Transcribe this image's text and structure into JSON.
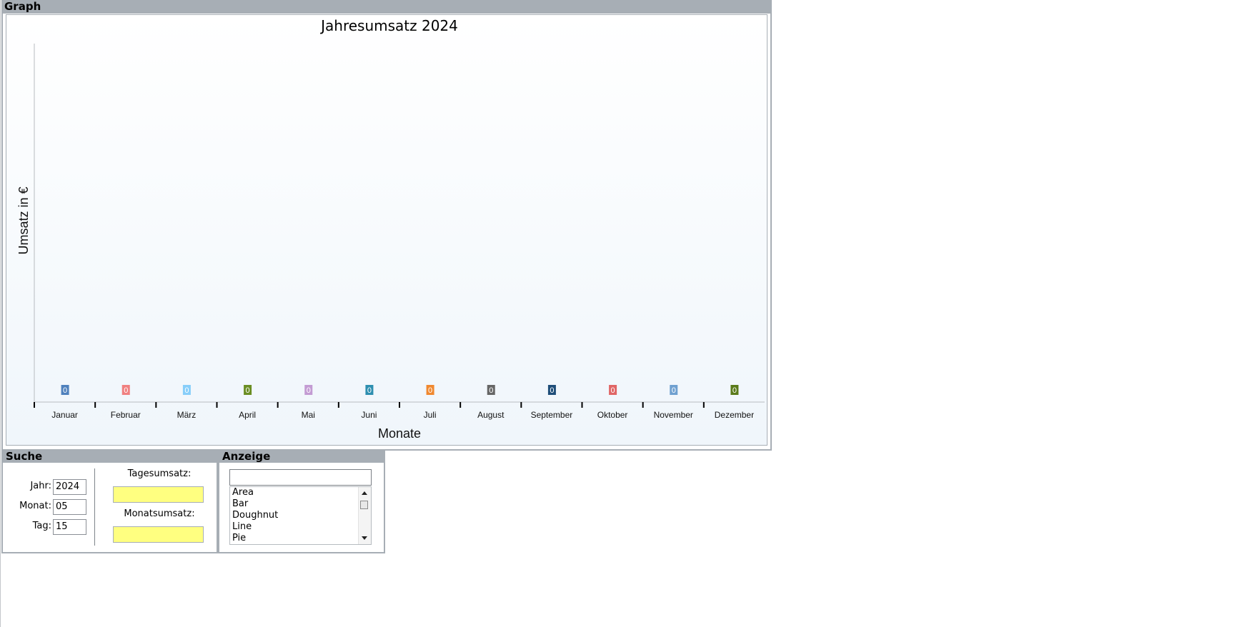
{
  "graph_panel": {
    "title": "Graph"
  },
  "chart_data": {
    "type": "bar",
    "title": "Jahresumsatz 2024",
    "xlabel": "Monate",
    "ylabel": "Umsatz in  €",
    "categories": [
      "Januar",
      "Februar",
      "März",
      "April",
      "Mai",
      "Juni",
      "Juli",
      "August",
      "September",
      "Oktober",
      "November",
      "Dezember"
    ],
    "values": [
      0,
      0,
      0,
      0,
      0,
      0,
      0,
      0,
      0,
      0,
      0,
      0
    ],
    "data_labels": [
      "0",
      "0",
      "0",
      "0",
      "0",
      "0",
      "0",
      "0",
      "0",
      "0",
      "0",
      "0"
    ],
    "colors": [
      "#4f81bd",
      "#f08080",
      "#87cefa",
      "#6b8e23",
      "#c39bd3",
      "#2e8fb0",
      "#f0882f",
      "#666666",
      "#1f4e79",
      "#e06666",
      "#6fa0d0",
      "#5a7a1a"
    ],
    "grid": false,
    "legend": "none"
  },
  "search_panel": {
    "title": "Suche",
    "year_label": "Jahr:",
    "year_value": "2024",
    "month_label": "Monat:",
    "month_value": "05",
    "day_label": "Tag:",
    "day_value": "15",
    "daily_sales_label": "Tagesumsatz:",
    "monthly_sales_label": "Monatsumsatz:",
    "highlight_color": "#ffff80"
  },
  "display_panel": {
    "title": "Anzeige",
    "filter_value": "",
    "chart_types": [
      "Area",
      "Bar",
      "Doughnut",
      "Line",
      "Pie"
    ]
  }
}
